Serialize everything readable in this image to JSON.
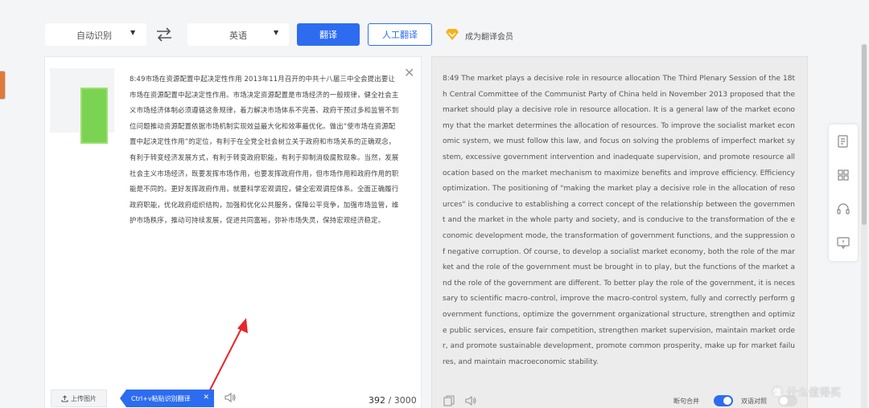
{
  "toolbar": {
    "source_lang": "自动识别",
    "target_lang": "英语",
    "translate_label": "翻译",
    "human_translate_label": "人工翻译",
    "vip_label": "成为翻译会员",
    "accent_color": "#2d6cf0"
  },
  "source": {
    "text": "8:49市场在资源配置中起决定性作用 2013年11月召开的中共十八届三中全会提出要让市场在资源配置中起决定性作用。市场决定资源配置是市场经济的一般规律，健全社会主义市场经济体制必须遵循这条规律，着力解决市场体系不完善、政府干预过多和监管不到位问题推动资源配置依据市场机制实现效益最大化和效率最优化。做出“使市场在资源配置中起决定性作用”的定位，有利于在全党全社会树立关于政府和市场关系的正确观念，有利于转变经济发展方式，有利于转变政府职能，有利于抑制消极腐败现象。当然，发展社会主义市场经济，既要发挥市场作用，也要发挥政府作用，但市场作用和政府作用的职能是不同的。更好发挥政府作用，就要科学宏观调控，健全宏观调控体系。全面正确履行政府职能，优化政府组织结构，加强和优化公共服务，保障公平竞争，加强市场监管，维护市场秩序，推动可持续发展，促进共同富裕，弥补市场失灵，保持宏观经济稳定。",
    "upload_label": "上传图片",
    "tag_label": "Ctrl+v粘贴识别翻译",
    "char_count": "392",
    "char_max": "3000"
  },
  "target": {
    "text": "8:49 The market plays a decisive role in resource allocation The Third Plenary Session of the 18th Central Committee of the Communist Party of China held in November 2013 proposed that the market should play a decisive role in resource allocation. It is a general law of the market economy that the market determines the allocation of resources. To improve the socialist market economic system, we must follow this law, and focus on solving the problems of imperfect market system, excessive government intervention and inadequate supervision, and promote resource allocation based on the market mechanism to maximize benefits and improve efficiency. Efficiency optimization. The positioning of \"making the market play a decisive role in the allocation of resources\" is conducive to establishing a correct concept of the relationship between the government and the market in the whole party and society, and is conducive to the transformation of the economic development mode, the transformation of government functions, and the suppression of negative corruption. Of course, to develop a socialist market economy, both the role of the market and the role of the government must be brought in to play, but the functions of the market and the role of the government are different. To better play the role of the government, it is necessary to scientific macro-control, improve the macro-control system, fully and correctly perform government functions, optimize the government organizational structure, strengthen and optimize public services, ensure fair competition, strengthen market supervision, maintain market order, and promote sustainable development, promote common prosperity, make up for market failures, and maintain macroeconomic stability.",
    "merge_label": "断句合并",
    "compare_label": "双语对照"
  },
  "watermark": {
    "badge": "值",
    "text": "什么值得买"
  }
}
